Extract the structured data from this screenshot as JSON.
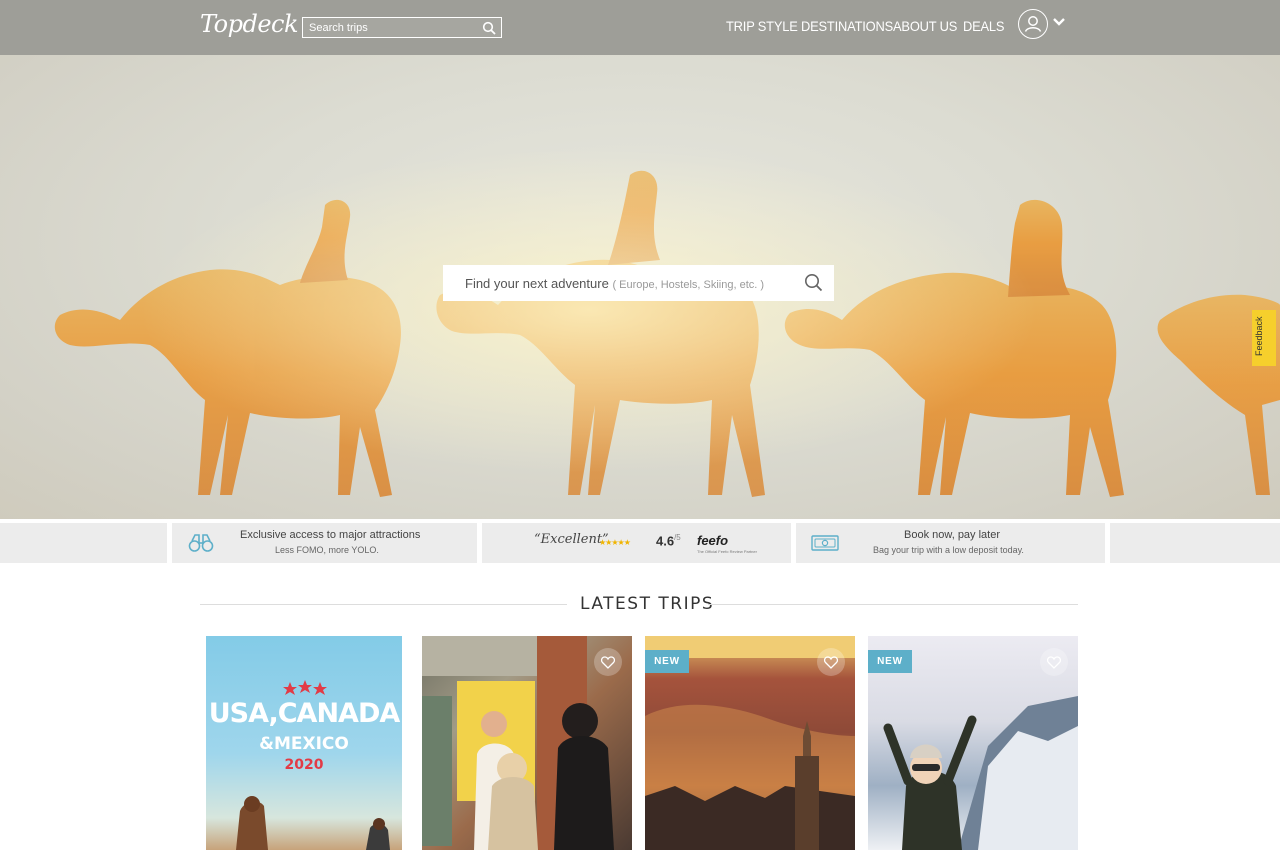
{
  "header": {
    "logo_text": "Topdeck",
    "search_placeholder": "Search trips",
    "nav": [
      "TRIP STYLE",
      "DESTINATIONS",
      "ABOUT US",
      "DEALS"
    ]
  },
  "hero": {
    "search_lead": "Find your next adventure",
    "search_hint": "( Europe, Hostels, Skiing, etc. )",
    "feedback_label": "Feedback"
  },
  "usps": {
    "attractions": {
      "title": "Exclusive access to major attractions",
      "sub": "Less FOMO, more YOLO."
    },
    "rating": {
      "quote": "“Excellent”",
      "score": "4.6",
      "out_of": "/5",
      "brand": "feefo",
      "brand_sub": "The Official Feefo Review Partner"
    },
    "deposit": {
      "title": "Book now, pay later",
      "sub": "Bag your trip with a low deposit today."
    }
  },
  "latest": {
    "heading": "LATEST TRIPS",
    "cards": [
      {
        "poster_line1": "USA,CANADA",
        "poster_line2": "&MEXICO",
        "poster_line3": "2020",
        "badge": "",
        "new": false
      },
      {
        "badge": "",
        "new": false
      },
      {
        "badge": "NEW",
        "new": true
      },
      {
        "badge": "NEW",
        "new": true
      }
    ]
  },
  "colors": {
    "header_bg": "#9e9e98",
    "badge": "#5dafc9",
    "feedback_tab": "#f6cf2c",
    "star": "#f0b400"
  }
}
